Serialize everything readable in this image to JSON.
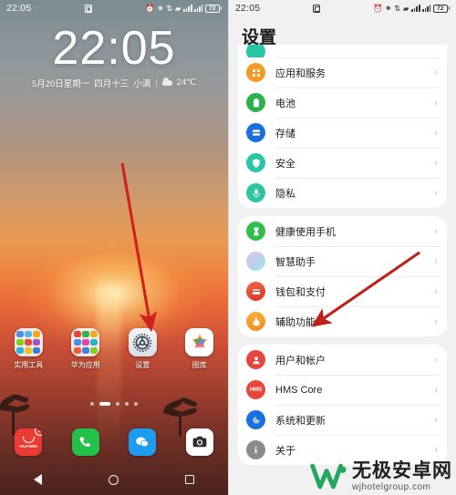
{
  "home": {
    "statusbar": {
      "time": "22:05",
      "battery_percent": "72",
      "icons": [
        "alarm-icon",
        "bluetooth-icon",
        "nfc-icon",
        "mobile-data-icon",
        "wifi-icon",
        "signal-icon-1",
        "signal-icon-2",
        "battery-icon"
      ]
    },
    "clock": "22:05",
    "date_solar": "5月20日星期一",
    "date_lunar": "四月十三",
    "solar_term": "小满",
    "temperature": "24℃",
    "apps": [
      {
        "label": "实用工具",
        "icon": "folder-icon"
      },
      {
        "label": "华为应用",
        "icon": "folder-icon"
      },
      {
        "label": "设置",
        "icon": "gear-icon"
      },
      {
        "label": "图库",
        "icon": "gallery-icon"
      }
    ],
    "page_dots": {
      "count": 5,
      "active_index": 1
    },
    "dock": [
      {
        "label": "应用市场",
        "icon": "huawei-appgallery-icon",
        "badge": "3"
      },
      {
        "label": "电话",
        "icon": "phone-icon",
        "badge": ""
      },
      {
        "label": "信息",
        "icon": "messages-icon",
        "badge": ""
      },
      {
        "label": "相机",
        "icon": "camera-icon",
        "badge": ""
      }
    ],
    "navbar": [
      "back-icon",
      "home-icon",
      "recents-icon"
    ],
    "annotation_arrow": {
      "color": "#d0221c",
      "points_to": "设置"
    }
  },
  "settings": {
    "statusbar": {
      "time": "22:05",
      "battery_percent": "72"
    },
    "title": "设置",
    "groups": [
      {
        "clipped_top": true,
        "items": [
          {
            "label": "应用和服务",
            "icon": "apps-services-icon",
            "color": "#f59a23",
            "chevron": "›"
          },
          {
            "label": "电池",
            "icon": "battery-icon",
            "color": "#2bb24c",
            "chevron": "›"
          },
          {
            "label": "存储",
            "icon": "storage-icon",
            "color": "#1a6fe0",
            "chevron": "›"
          },
          {
            "label": "安全",
            "icon": "shield-icon",
            "color": "#26c6a6",
            "chevron": "›"
          },
          {
            "label": "隐私",
            "icon": "privacy-icon",
            "color": "#2ec4a0",
            "chevron": "›"
          }
        ]
      },
      {
        "clipped_top": false,
        "items": [
          {
            "label": "健康使用手机",
            "icon": "digital-balance-icon",
            "color": "#30bf4a",
            "chevron": "›"
          },
          {
            "label": "智慧助手",
            "icon": "ai-assistant-icon",
            "color": "#b8c6ea",
            "chevron": "›"
          },
          {
            "label": "钱包和支付",
            "icon": "wallet-icon",
            "color": "#e8453c",
            "chevron": "›"
          },
          {
            "label": "辅助功能",
            "icon": "accessibility-icon",
            "color": "#f5a623",
            "chevron": "›"
          }
        ]
      },
      {
        "clipped_top": false,
        "items": [
          {
            "label": "用户和帐户",
            "icon": "user-account-icon",
            "color": "#e8453c",
            "chevron": "›"
          },
          {
            "label": "HMS Core",
            "icon": "hms-core-icon",
            "color": "#e8453c",
            "chevron": "›"
          },
          {
            "label": "系统和更新",
            "icon": "system-update-icon",
            "color": "#1a6fe0",
            "chevron": "›"
          },
          {
            "label": "关于",
            "icon": "about-icon",
            "color": "#8b8b8b",
            "chevron": "›"
          }
        ]
      }
    ],
    "annotation_arrow": {
      "color": "#c0201a",
      "points_to": "辅助功能"
    }
  },
  "watermark": {
    "title": "无极安卓网",
    "url": "wjhotelgroup.com",
    "logo_color": "#21a85c"
  }
}
